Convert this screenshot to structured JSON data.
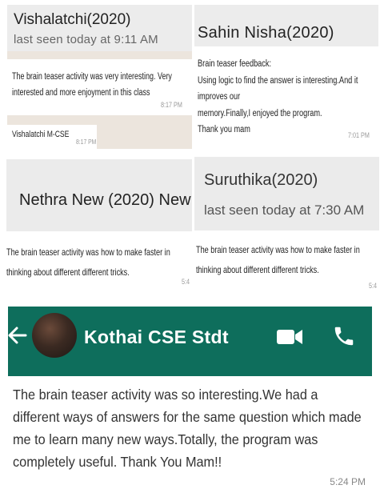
{
  "panel1": {
    "contact_name": "Vishalatchi(2020)",
    "status": "last seen today at 9:11 AM",
    "message1": "The brain teaser activity was very interesting. Very  interested and more enjoyment in this class",
    "message1_time": "8:17 PM",
    "message2": "Vishalatchi M-CSE",
    "message2_time": "8:17 PM"
  },
  "panel2": {
    "contact_name": "Sahin Nisha(2020)",
    "message": "Brain teaser feedback: Using logic to find the answer is interesting.And it improves our memory.Finally,I enjoyed the program. Thank you mam",
    "message_lines": [
      "Brain teaser feedback:",
      "Using logic to find the answer is interesting.And it improves our",
      "memory.Finally,I enjoyed the program.",
      "Thank you mam"
    ],
    "time": "7:01 PM"
  },
  "panel3": {
    "contact_name": "Nethra New (2020) New",
    "message": "The brain teaser activity was how to make faster in thinking about different different tricks.",
    "time": "5:4"
  },
  "panel4": {
    "contact_name": "Suruthika(2020)",
    "status": "last seen today at 7:30 AM",
    "message": "The brain teaser activity was how to make faster in thinking about different different tricks.",
    "time": "5:4"
  },
  "panel5": {
    "contact_name": "Kothai CSE Stdt",
    "message": "The brain teaser activity was so interesting.We had a different ways of answers for the same question which made me to learn many new ways.Totally, the program was completely useful. Thank You Mam!!",
    "time": "5:24 PM",
    "header_color": "#0e6e5c",
    "icons": [
      "back-arrow-icon",
      "avatar",
      "video-call-icon",
      "phone-icon"
    ]
  }
}
